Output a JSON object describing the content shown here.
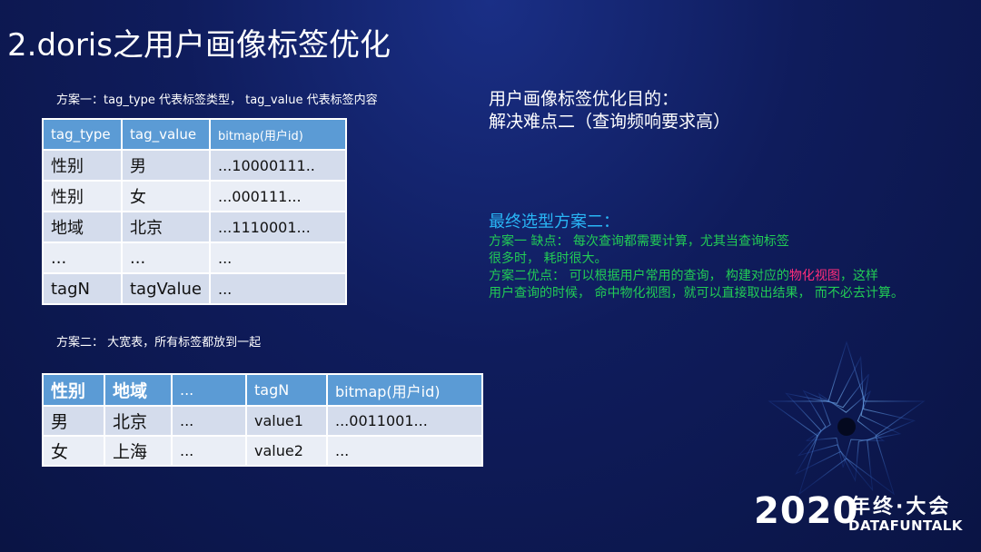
{
  "title": "2.doris之用户画像标签优化",
  "scheme1": {
    "caption": "方案一：tag_type 代表标签类型， tag_value 代表标签内容",
    "headers": [
      "tag_type",
      "tag_value",
      "bitmap(用户id)"
    ],
    "rows": [
      [
        "性别",
        "男",
        "...10000111.."
      ],
      [
        "性别",
        "女",
        "...000111..."
      ],
      [
        "地域",
        "北京",
        "...1110001..."
      ],
      [
        "...",
        "...",
        "..."
      ],
      [
        "tagN",
        "tagValue",
        "..."
      ]
    ]
  },
  "scheme2": {
    "caption": "方案二： 大宽表，所有标签都放到一起",
    "headers": [
      "性别",
      "地域",
      "...",
      "tagN",
      "bitmap(用户id)"
    ],
    "rows": [
      [
        "男",
        "北京",
        "...",
        "value1",
        "...0011001..."
      ],
      [
        "女",
        "上海",
        "...",
        "value2",
        "..."
      ]
    ]
  },
  "right": {
    "goal_line1": "用户画像标签优化目的：",
    "goal_line2": "解决难点二（查询频响要求高）",
    "final_choice": "最终选型方案二：",
    "line1": "方案一 缺点：  每次查询都需要计算，尤其当查询标签",
    "line2": "很多时，  耗时很大。",
    "line3a": "方案二优点：  可以根据用户常用的查询， 构建对应的",
    "line3b": "物化视图",
    "line3c": "，这样",
    "line4": "用户查询的时候， 命中物化视图，就可以直接取出结果， 而不必去计算。"
  },
  "brand": {
    "year": "2020",
    "cn": "年终·大会",
    "en": "DATAFUNTALK"
  },
  "colors": {
    "background": "#0f1c5c",
    "table_header": "#5b9bd5",
    "row_odd": "#d4dcec",
    "row_even": "#eaeef6",
    "final_choice": "#29b6f6",
    "green_text": "#22cc55",
    "highlight": "#ff2d7a"
  },
  "icons": [
    "star-logo-icon"
  ]
}
